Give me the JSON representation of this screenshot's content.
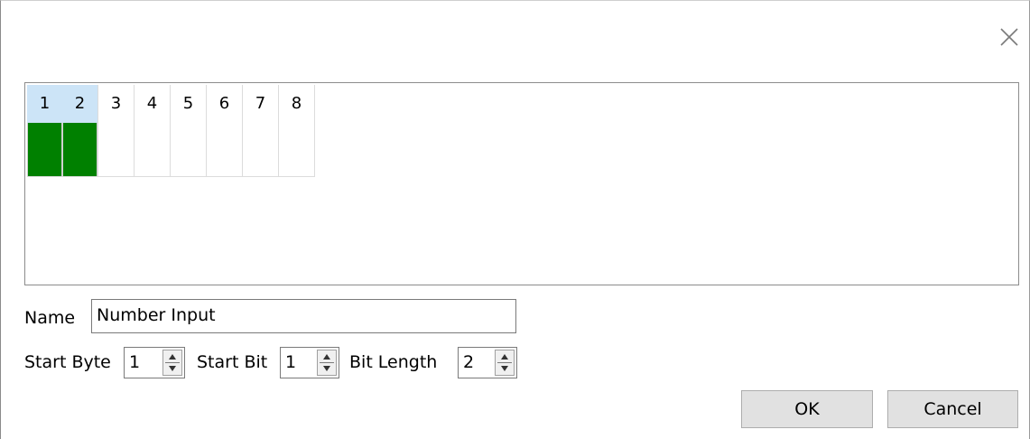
{
  "dialog": {
    "bits": {
      "headers": [
        "1",
        "2",
        "3",
        "4",
        "5",
        "6",
        "7",
        "8"
      ],
      "selected_bits": [
        1,
        2
      ],
      "filled_color": "#008000",
      "selected_header_color": "#cce4f7"
    },
    "name": {
      "label": "Name",
      "value": "Number Input"
    },
    "start_byte": {
      "label": "Start Byte",
      "value": "1"
    },
    "start_bit": {
      "label": "Start Bit",
      "value": "1"
    },
    "bit_length": {
      "label": "Bit Length",
      "value": "2"
    },
    "buttons": {
      "ok": "OK",
      "cancel": "Cancel"
    },
    "close_icon": "close-icon"
  }
}
